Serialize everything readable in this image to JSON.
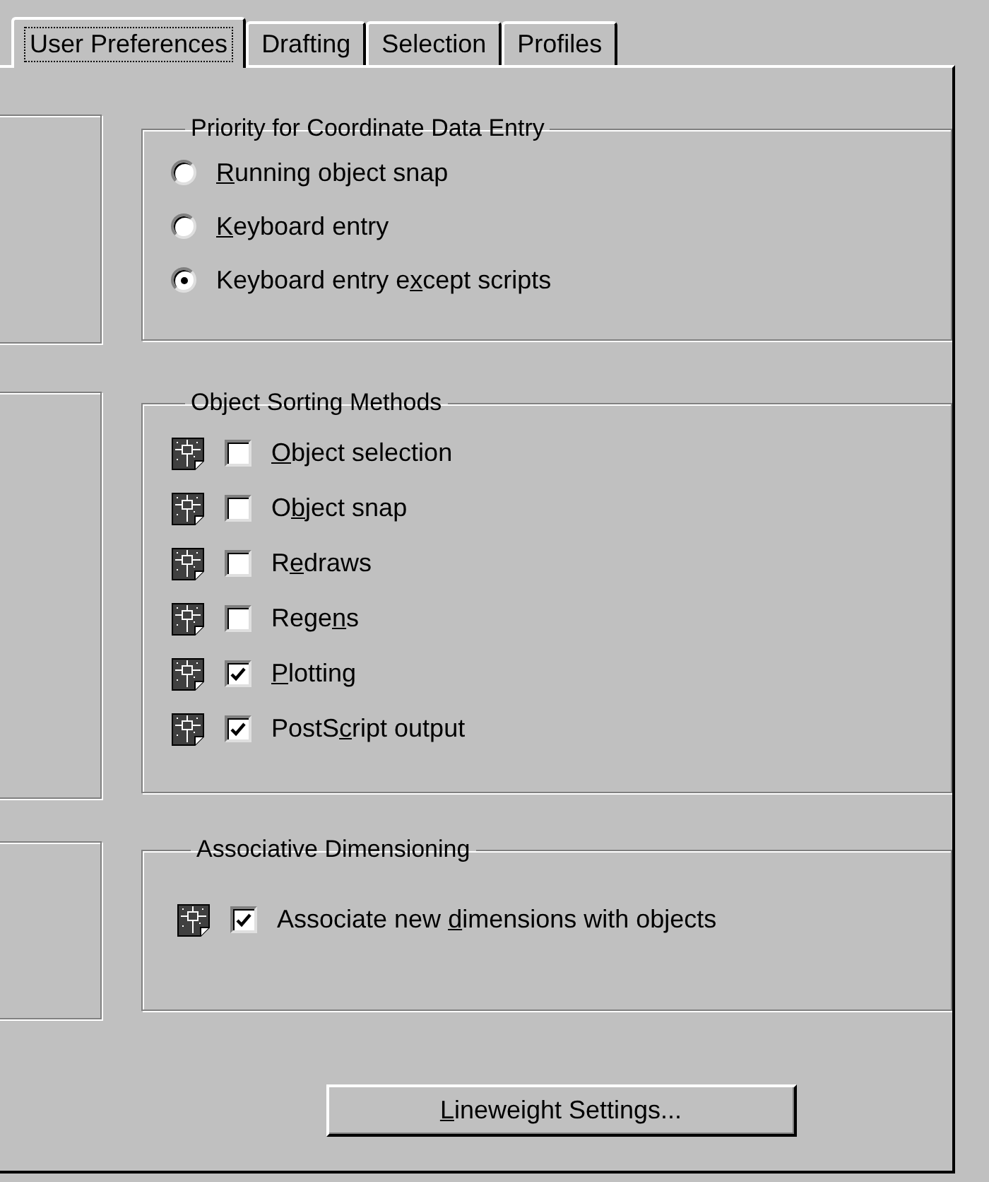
{
  "tabs": [
    {
      "label": "User Preferences",
      "selected": true
    },
    {
      "label": "Drafting",
      "selected": false
    },
    {
      "label": "Selection",
      "selected": false
    },
    {
      "label": "Profiles",
      "selected": false
    }
  ],
  "priority_group": {
    "title": "Priority for Coordinate Data Entry",
    "options": [
      {
        "access_key": "R",
        "label_after": "unning object snap",
        "selected": false
      },
      {
        "access_key": "K",
        "label_after": "eyboard entry",
        "selected": false
      },
      {
        "label_before": "Keyboard entry e",
        "access_key": "x",
        "label_after": "cept scripts",
        "selected": true
      }
    ]
  },
  "sorting_group": {
    "title": "Object Sorting Methods",
    "items": [
      {
        "access_key": "O",
        "label_after": "bject selection",
        "checked": false
      },
      {
        "label_before": "O",
        "access_key": "b",
        "label_after": "ject snap",
        "checked": false
      },
      {
        "label_before": "R",
        "access_key": "e",
        "label_after": "draws",
        "checked": false
      },
      {
        "label_before": "Rege",
        "access_key": "n",
        "label_after": "s",
        "checked": false
      },
      {
        "access_key": "P",
        "label_after": "lotting",
        "checked": true
      },
      {
        "label_before": "PostS",
        "access_key": "c",
        "label_after": "ript output",
        "checked": true
      }
    ]
  },
  "dimensioning_group": {
    "title": "Associative Dimensioning",
    "items": [
      {
        "label_before": "Associate new ",
        "access_key": "d",
        "label_after": "imensions with objects",
        "checked": true
      }
    ]
  },
  "lineweight_button": {
    "access_key": "L",
    "label_after": "ineweight Settings..."
  }
}
